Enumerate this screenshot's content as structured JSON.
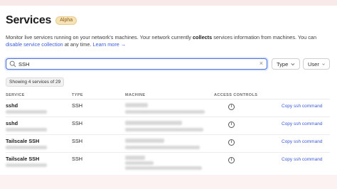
{
  "header": {
    "title": "Services",
    "badge": "Alpha",
    "desc_1": "Monitor live services running on your network's machines. Your network currently",
    "desc_bold": "collects",
    "desc_2": "services information from machines. You can",
    "desc_link_disable": "disable service collection",
    "desc_3": "at any time.",
    "desc_link_learn": "Learn more →"
  },
  "filters": {
    "search_value": "SSH",
    "clear_icon": "×",
    "type_label": "Type",
    "user_label": "User"
  },
  "results": {
    "count_label": "Showing 4 services of 29"
  },
  "table": {
    "columns": [
      "SERVICE",
      "TYPE",
      "MACHINE",
      "ACCESS CONTROLS"
    ],
    "rows": [
      {
        "service": "sshd",
        "type": "SSH",
        "action": "Copy ssh command"
      },
      {
        "service": "sshd",
        "type": "SSH",
        "action": "Copy ssh command"
      },
      {
        "service": "Tailscale SSH",
        "type": "SSH",
        "action": "Copy ssh command"
      },
      {
        "service": "Tailscale SSH",
        "type": "SSH",
        "action": "Copy ssh command"
      }
    ]
  },
  "icons": [
    "search-icon",
    "chevron-down-icon",
    "info-icon",
    "clear-icon"
  ]
}
